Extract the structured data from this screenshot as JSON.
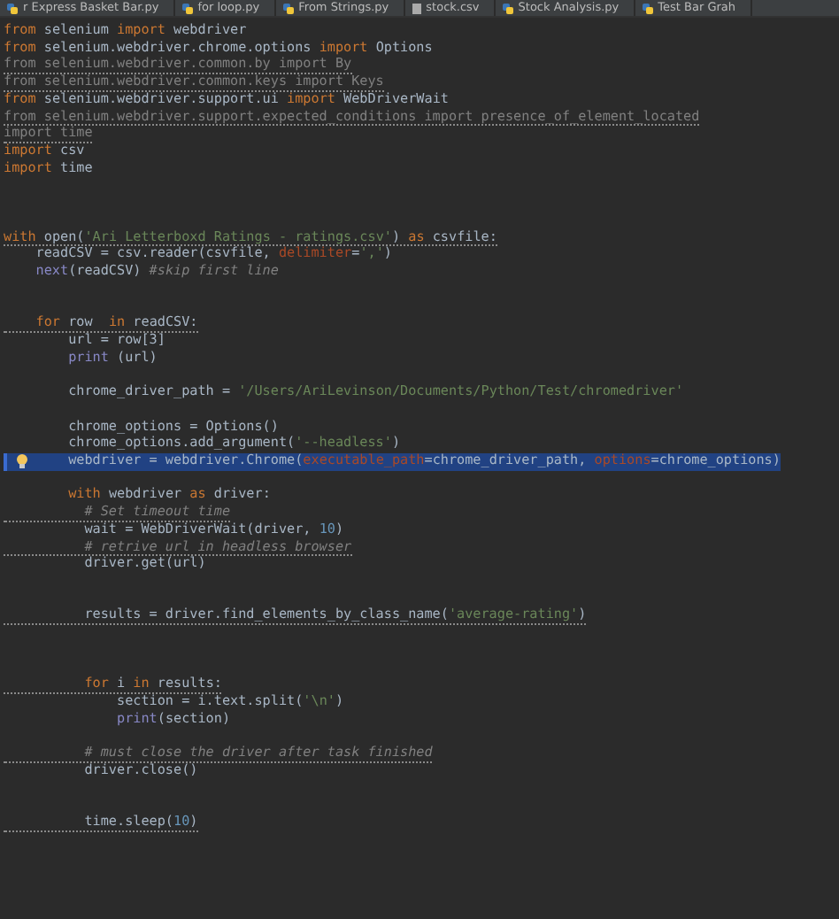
{
  "tabs": [
    {
      "label": "r Express Basket Bar.py",
      "kind": "python",
      "selected": false
    },
    {
      "label": "for loop.py",
      "kind": "python",
      "selected": false
    },
    {
      "label": "From Strings.py",
      "kind": "python",
      "selected": false
    },
    {
      "label": "stock.csv",
      "kind": "file",
      "selected": false
    },
    {
      "label": "Stock Analysis.py",
      "kind": "python",
      "selected": false
    },
    {
      "label": "Test Bar Grah",
      "kind": "python",
      "selected": false
    }
  ],
  "lines": [
    {
      "kind": "code",
      "warning": false,
      "selected": false,
      "tokens": [
        {
          "text": "from",
          "kind": "keyword"
        },
        {
          "text": " selenium ",
          "kind": "plain"
        },
        {
          "text": "import",
          "kind": "keyword"
        },
        {
          "text": " webdriver",
          "kind": "plain"
        }
      ]
    },
    {
      "kind": "code",
      "warning": false,
      "selected": false,
      "tokens": [
        {
          "text": "from",
          "kind": "keyword"
        },
        {
          "text": " selenium.webdriver.chrome.options ",
          "kind": "plain"
        },
        {
          "text": "import",
          "kind": "keyword"
        },
        {
          "text": " Options",
          "kind": "plain"
        }
      ]
    },
    {
      "kind": "code",
      "warning": true,
      "selected": false,
      "tokens": [
        {
          "text": "from selenium.webdriver.common.by import By",
          "kind": "unused"
        }
      ]
    },
    {
      "kind": "code",
      "warning": true,
      "selected": false,
      "tokens": [
        {
          "text": "from selenium.webdriver.common.keys import Keys",
          "kind": "unused"
        }
      ]
    },
    {
      "kind": "code",
      "warning": false,
      "selected": false,
      "tokens": [
        {
          "text": "from",
          "kind": "keyword"
        },
        {
          "text": " selenium.webdriver.support.ui ",
          "kind": "plain"
        },
        {
          "text": "import",
          "kind": "keyword"
        },
        {
          "text": " WebDriverWait",
          "kind": "plain"
        }
      ]
    },
    {
      "kind": "code",
      "warning": true,
      "selected": false,
      "tokens": [
        {
          "text": "from selenium.webdriver.support.expected_conditions import presence_of_element_located",
          "kind": "unused"
        }
      ]
    },
    {
      "kind": "code",
      "warning": true,
      "selected": false,
      "tokens": [
        {
          "text": "import time",
          "kind": "unused"
        }
      ]
    },
    {
      "kind": "code",
      "warning": false,
      "selected": false,
      "tokens": [
        {
          "text": "import",
          "kind": "keyword"
        },
        {
          "text": " csv",
          "kind": "plain"
        }
      ]
    },
    {
      "kind": "code",
      "warning": false,
      "selected": false,
      "tokens": [
        {
          "text": "import",
          "kind": "keyword"
        },
        {
          "text": " time",
          "kind": "plain"
        }
      ]
    },
    {
      "kind": "blank"
    },
    {
      "kind": "blank"
    },
    {
      "kind": "blank"
    },
    {
      "kind": "code",
      "warning": true,
      "selected": false,
      "tokens": [
        {
          "text": "with",
          "kind": "keyword"
        },
        {
          "text": " open(",
          "kind": "plain"
        },
        {
          "text": "'Ari Letterboxd Ratings - ratings.csv'",
          "kind": "string"
        },
        {
          "text": ") ",
          "kind": "plain"
        },
        {
          "text": "as",
          "kind": "keyword"
        },
        {
          "text": " csvfile:",
          "kind": "plain"
        }
      ]
    },
    {
      "kind": "code",
      "warning": false,
      "selected": false,
      "tokens": [
        {
          "text": "    readCSV = csv.reader(csvfile, ",
          "kind": "plain"
        },
        {
          "text": "delimiter",
          "kind": "param"
        },
        {
          "text": "=",
          "kind": "plain"
        },
        {
          "text": "','",
          "kind": "string"
        },
        {
          "text": ")",
          "kind": "plain"
        }
      ]
    },
    {
      "kind": "code",
      "warning": false,
      "selected": false,
      "tokens": [
        {
          "text": "    next",
          "kind": "builtin"
        },
        {
          "text": "(readCSV) ",
          "kind": "plain"
        },
        {
          "text": "#skip first line",
          "kind": "comment"
        }
      ]
    },
    {
      "kind": "blank"
    },
    {
      "kind": "blank"
    },
    {
      "kind": "code",
      "warning": true,
      "selected": false,
      "tokens": [
        {
          "text": "    for",
          "kind": "keyword"
        },
        {
          "text": " row  ",
          "kind": "plain"
        },
        {
          "text": "in",
          "kind": "keyword"
        },
        {
          "text": " readCSV:",
          "kind": "plain"
        }
      ]
    },
    {
      "kind": "code",
      "warning": false,
      "selected": false,
      "tokens": [
        {
          "text": "        url = row[3]",
          "kind": "plain"
        }
      ]
    },
    {
      "kind": "code",
      "warning": false,
      "selected": false,
      "tokens": [
        {
          "text": "        print",
          "kind": "builtin"
        },
        {
          "text": " (url)",
          "kind": "plain"
        }
      ]
    },
    {
      "kind": "blank"
    },
    {
      "kind": "code",
      "warning": false,
      "selected": false,
      "tokens": [
        {
          "text": "        chrome_driver_path = ",
          "kind": "plain"
        },
        {
          "text": "'/Users/AriLevinson/Documents/Python/Test/chromedriver'",
          "kind": "string"
        }
      ]
    },
    {
      "kind": "blank"
    },
    {
      "kind": "code",
      "warning": false,
      "selected": false,
      "tokens": [
        {
          "text": "        chrome_options = Options()",
          "kind": "plain"
        }
      ]
    },
    {
      "kind": "code",
      "warning": false,
      "selected": false,
      "tokens": [
        {
          "text": "        chrome_options.add_argument(",
          "kind": "plain"
        },
        {
          "text": "'--headless'",
          "kind": "string"
        },
        {
          "text": ")",
          "kind": "plain"
        }
      ]
    },
    {
      "kind": "code",
      "warning": false,
      "selected": true,
      "tokens": [
        {
          "text": "        webdriver = webdriver.Chrome(",
          "kind": "plain"
        },
        {
          "text": "executable_path",
          "kind": "param"
        },
        {
          "text": "=chrome_driver_path, ",
          "kind": "plain"
        },
        {
          "text": "options",
          "kind": "param"
        },
        {
          "text": "=chrome_options)",
          "kind": "plain"
        }
      ]
    },
    {
      "kind": "blank"
    },
    {
      "kind": "code",
      "warning": false,
      "selected": false,
      "tokens": [
        {
          "text": "        with",
          "kind": "keyword"
        },
        {
          "text": " webdriver ",
          "kind": "plain"
        },
        {
          "text": "as",
          "kind": "keyword"
        },
        {
          "text": " driver:",
          "kind": "plain"
        }
      ]
    },
    {
      "kind": "code",
      "warning": true,
      "selected": false,
      "tokens": [
        {
          "text": "          # Set timeout time",
          "kind": "comment"
        }
      ]
    },
    {
      "kind": "code",
      "warning": false,
      "selected": false,
      "tokens": [
        {
          "text": "          wait = WebDriverWait(driver, ",
          "kind": "plain"
        },
        {
          "text": "10",
          "kind": "number"
        },
        {
          "text": ")",
          "kind": "plain"
        }
      ]
    },
    {
      "kind": "code",
      "warning": true,
      "selected": false,
      "tokens": [
        {
          "text": "          # retrive url in headless browser",
          "kind": "comment"
        }
      ]
    },
    {
      "kind": "code",
      "warning": false,
      "selected": false,
      "tokens": [
        {
          "text": "          driver.get(url)",
          "kind": "plain"
        }
      ]
    },
    {
      "kind": "blank"
    },
    {
      "kind": "blank"
    },
    {
      "kind": "code",
      "warning": true,
      "selected": false,
      "tokens": [
        {
          "text": "          results = driver.find_elements_by_class_name(",
          "kind": "plain"
        },
        {
          "text": "'average-rating'",
          "kind": "string"
        },
        {
          "text": ")",
          "kind": "plain"
        }
      ]
    },
    {
      "kind": "blank"
    },
    {
      "kind": "blank"
    },
    {
      "kind": "blank"
    },
    {
      "kind": "code",
      "warning": true,
      "selected": false,
      "tokens": [
        {
          "text": "          for",
          "kind": "keyword"
        },
        {
          "text": " i ",
          "kind": "plain"
        },
        {
          "text": "in",
          "kind": "keyword"
        },
        {
          "text": " results:",
          "kind": "plain"
        }
      ]
    },
    {
      "kind": "code",
      "warning": false,
      "selected": false,
      "tokens": [
        {
          "text": "              section = i.text.split(",
          "kind": "plain"
        },
        {
          "text": "'\\n'",
          "kind": "string"
        },
        {
          "text": ")",
          "kind": "plain"
        }
      ]
    },
    {
      "kind": "code",
      "warning": false,
      "selected": false,
      "tokens": [
        {
          "text": "              print",
          "kind": "builtin"
        },
        {
          "text": "(section)",
          "kind": "plain"
        }
      ]
    },
    {
      "kind": "blank"
    },
    {
      "kind": "code",
      "warning": true,
      "selected": false,
      "tokens": [
        {
          "text": "          # must close the driver after task finished",
          "kind": "comment"
        }
      ]
    },
    {
      "kind": "code",
      "warning": false,
      "selected": false,
      "tokens": [
        {
          "text": "          driver.close()",
          "kind": "plain"
        }
      ]
    },
    {
      "kind": "blank"
    },
    {
      "kind": "blank"
    },
    {
      "kind": "code",
      "warning": true,
      "selected": false,
      "tokens": [
        {
          "text": "          time.sleep(",
          "kind": "plain"
        },
        {
          "text": "10",
          "kind": "number"
        },
        {
          "text": ")",
          "kind": "plain"
        }
      ]
    }
  ]
}
